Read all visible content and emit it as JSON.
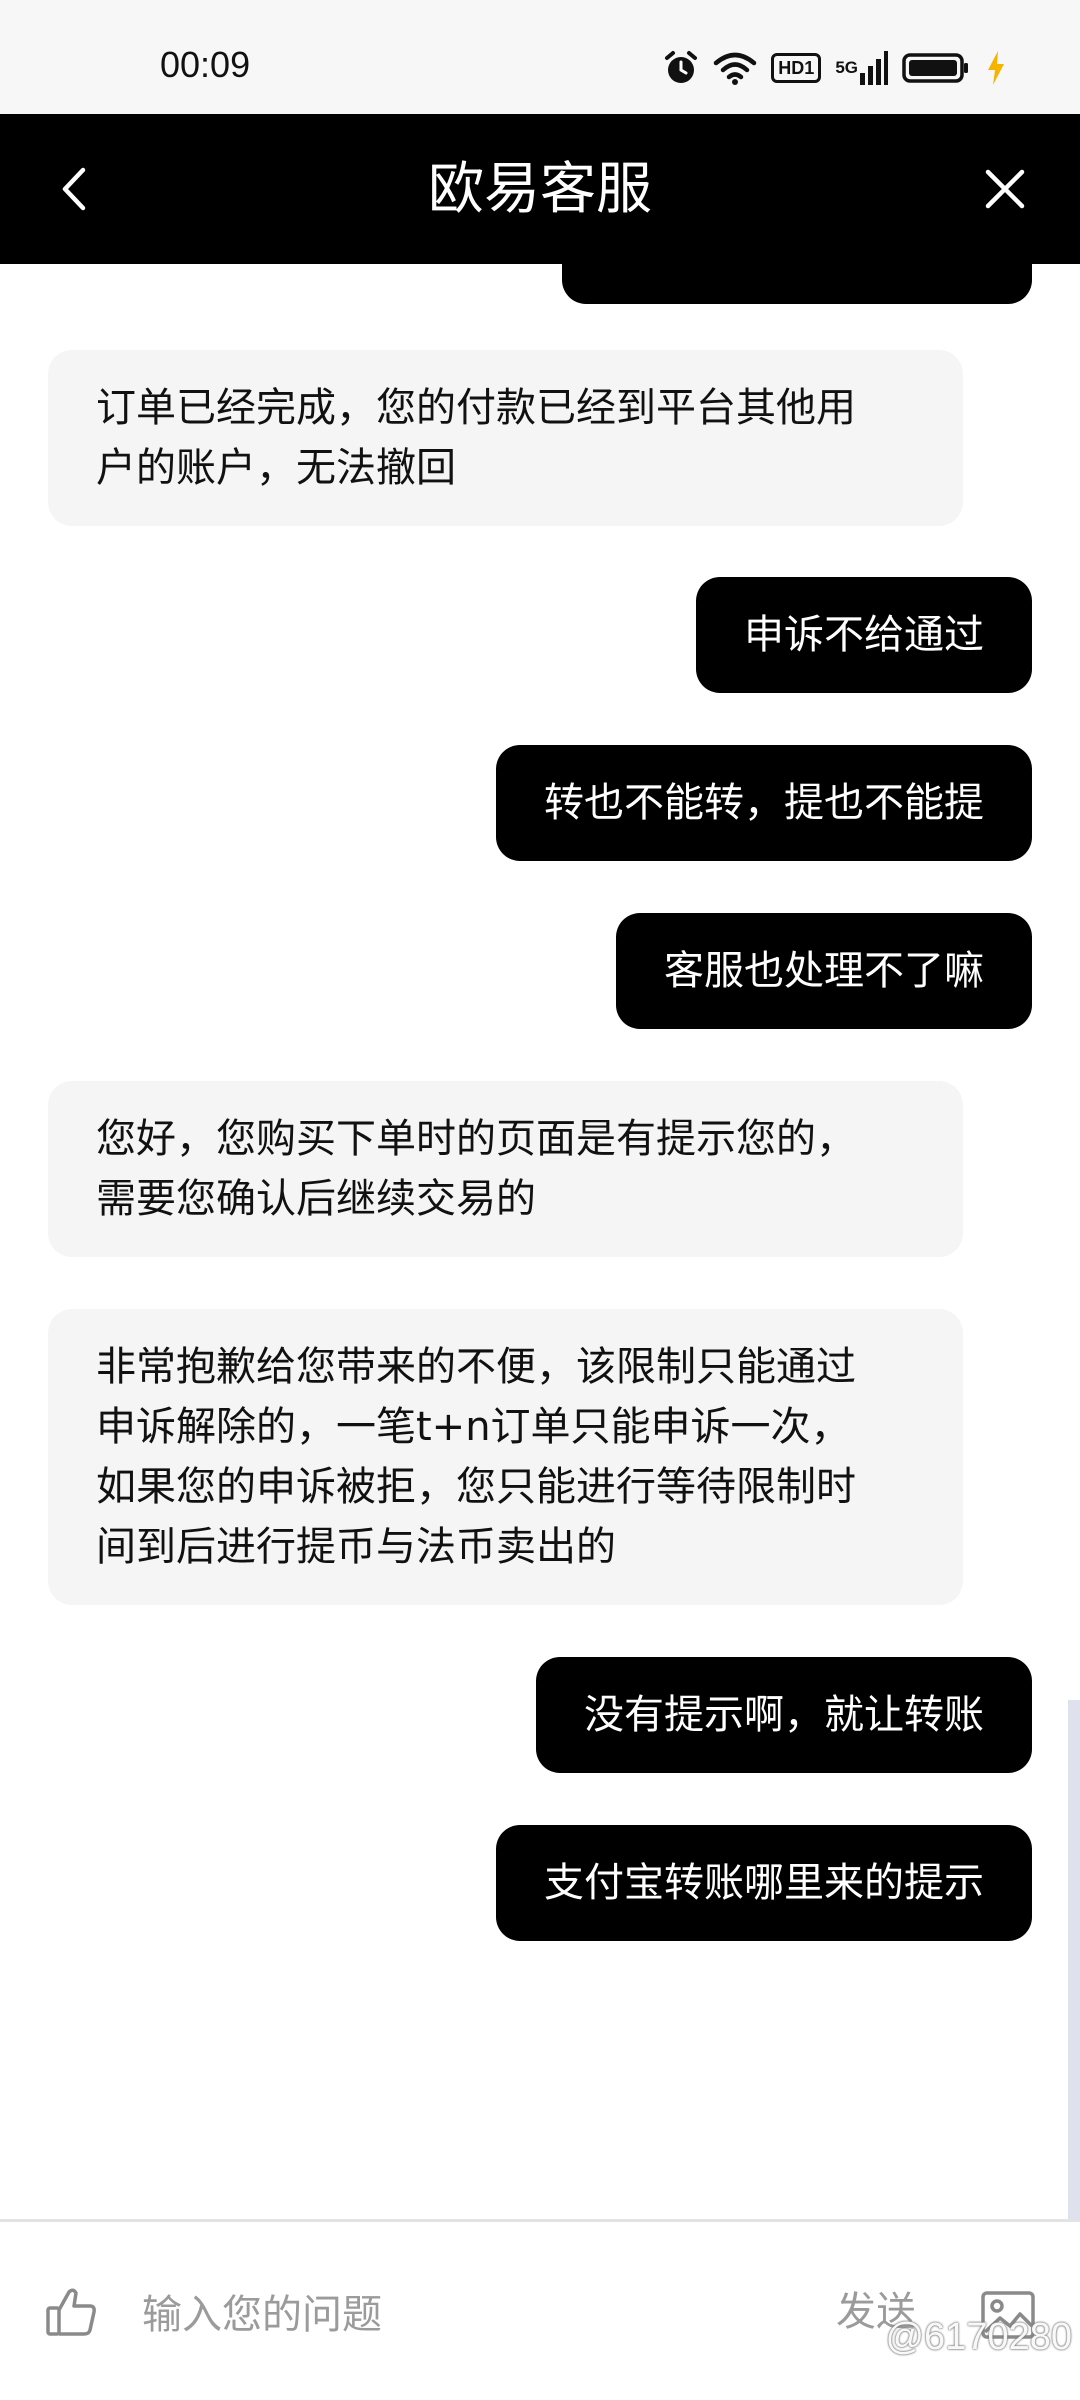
{
  "status_bar": {
    "time": "00:09",
    "hd_label": "HD1",
    "network_label": "5G"
  },
  "header": {
    "title": "欧易客服"
  },
  "messages": [
    {
      "role": "agent",
      "lines": [
        "订单已经完成，您的付款已经到平台其他用",
        "户的账户，无法撤回"
      ]
    },
    {
      "role": "user",
      "text": "申诉不给通过"
    },
    {
      "role": "user",
      "text": "转也不能转，提也不能提"
    },
    {
      "role": "user",
      "text": "客服也处理不了嘛"
    },
    {
      "role": "agent",
      "lines": [
        "您好，您购买下单时的页面是有提示您的，",
        "需要您确认后继续交易的"
      ]
    },
    {
      "role": "agent",
      "lines": [
        "非常抱歉给您带来的不便，该限制只能通过",
        "申诉解除的，一笔t+n订单只能申诉一次，",
        "如果您的申诉被拒，您只能进行等待限制时",
        "间到后进行提币与法币卖出的"
      ]
    },
    {
      "role": "user",
      "text": "没有提示啊，就让转账"
    },
    {
      "role": "user",
      "text": "支付宝转账哪里来的提示"
    }
  ],
  "input_bar": {
    "placeholder": "输入您的问题",
    "send_label": "发送"
  },
  "watermark": "@6170280",
  "colors": {
    "header_bg": "#000000",
    "user_bubble": "#000000",
    "agent_bubble": "#f5f5f5",
    "status_bar_bg": "#f7f7f7",
    "charging_bolt": "#f5b400"
  },
  "icons": {
    "back": "chevron-left-icon",
    "close": "close-icon",
    "like": "thumbs-up-icon",
    "image": "image-icon",
    "alarm": "alarm-icon",
    "wifi": "wifi-icon",
    "signal": "signal-icon",
    "battery": "battery-icon"
  }
}
